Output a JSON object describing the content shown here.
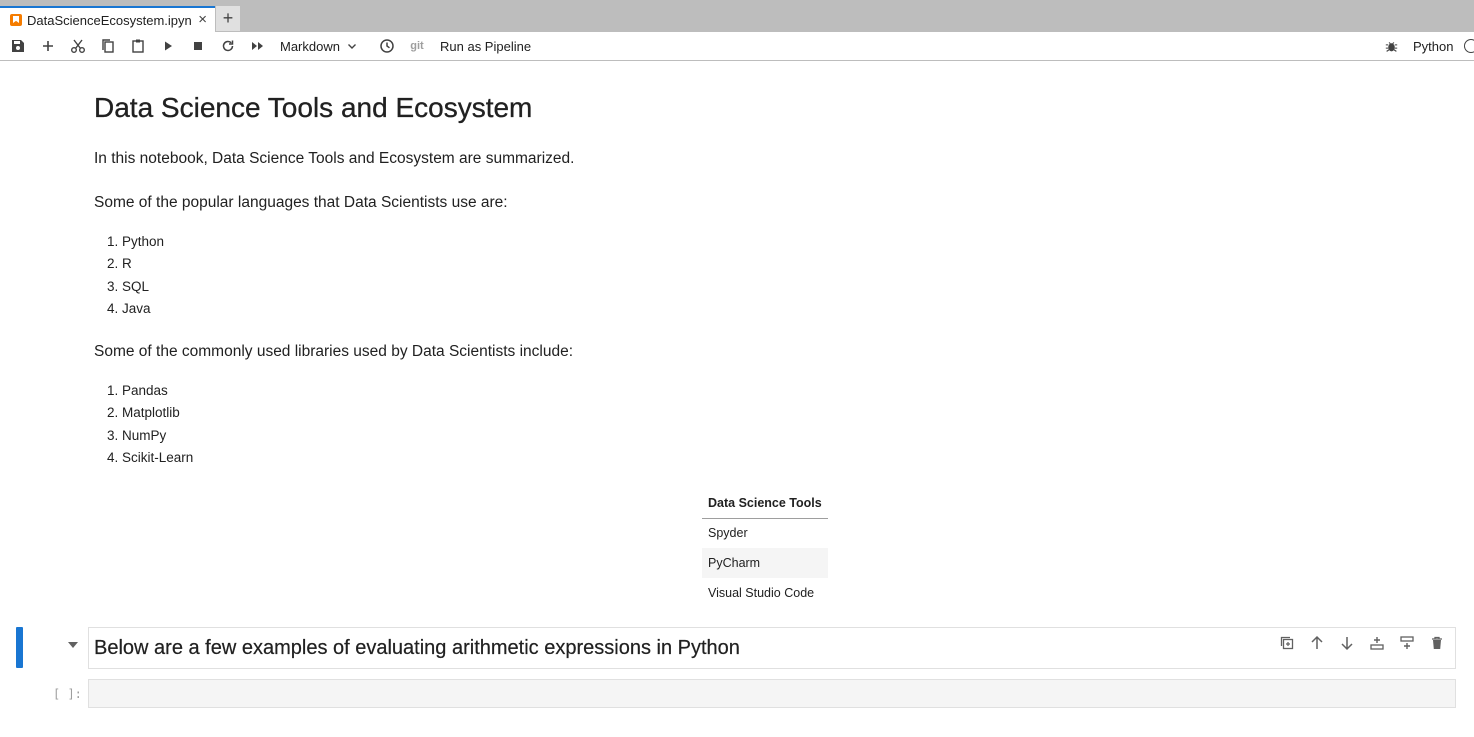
{
  "tab": {
    "label": "DataScienceEcosystem.ipynb",
    "close_label": "×",
    "add_label": "+"
  },
  "toolbar": {
    "cell_type": "Markdown",
    "git_label": "git",
    "pipeline_label": "Run as Pipeline",
    "kernel_name": "Python",
    "icons": [
      "save-icon",
      "add-icon",
      "cut-icon",
      "copy-icon",
      "paste-icon",
      "run-icon",
      "stop-icon",
      "restart-icon",
      "fast-forward-icon",
      "chevron-down-icon",
      "clock-icon",
      "bug-icon",
      "kernel-status-icon"
    ]
  },
  "notebook": {
    "title": "Data Science Tools and Ecosystem",
    "intro": "In this notebook, Data Science Tools and Ecosystem are summarized.",
    "languages_intro": "Some of the popular languages that Data Scientists use are:",
    "languages": [
      "1. Python",
      "2. R",
      "3. SQL",
      "4. Java"
    ],
    "libraries_intro": "Some of the commonly used libraries used by Data Scientists include:",
    "libraries": [
      "1. Pandas",
      "2. Matplotlib",
      "3. NumPy",
      "4. Scikit-Learn"
    ],
    "tools_table": {
      "header": "Data Science Tools",
      "rows": [
        "Spyder",
        "PyCharm",
        "Visual Studio Code"
      ]
    },
    "active_cell_heading": "Below are a few examples of evaluating arithmetic expressions in Python",
    "code_prompt": "[ ]:",
    "cell_tool_icons": [
      "duplicate-icon",
      "move-up-icon",
      "move-down-icon",
      "insert-above-icon",
      "insert-below-icon",
      "delete-icon"
    ]
  },
  "colors": {
    "accent": "#1976d2",
    "tabbar_bg": "#bdbdbd",
    "tab_icon": "#f57c00"
  }
}
